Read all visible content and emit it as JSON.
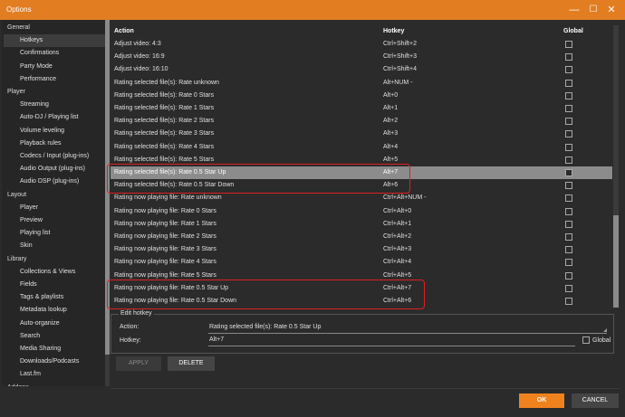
{
  "window": {
    "title": "Options",
    "controls": {
      "minimize": "—",
      "maximize": "☐",
      "close": "✕"
    }
  },
  "sidebar": {
    "groups": [
      {
        "label": "General",
        "items": [
          "Hotkeys",
          "Confirmations",
          "Party Mode",
          "Performance"
        ]
      },
      {
        "label": "Player",
        "items": [
          "Streaming",
          "Auto-DJ / Playing list",
          "Volume leveling",
          "Playback rules",
          "Codecs / Input (plug-ins)",
          "Audio Output (plug-ins)",
          "Audio DSP (plug-ins)"
        ]
      },
      {
        "label": "Layout",
        "items": [
          "Player",
          "Preview",
          "Playing list",
          "Skin"
        ]
      },
      {
        "label": "Library",
        "items": [
          "Collections & Views",
          "Fields",
          "Tags & playlists",
          "Metadata lookup",
          "Auto-organize",
          "Search",
          "Media Sharing",
          "Downloads/Podcasts",
          "Last.fm"
        ]
      },
      {
        "label": "Addons",
        "items": []
      }
    ],
    "selected": "Hotkeys"
  },
  "table": {
    "headers": {
      "action": "Action",
      "hotkey": "Hotkey",
      "global": "Global"
    },
    "rows": [
      {
        "action": "Adjust video: 4:3",
        "hotkey": "Ctrl+Shift+2"
      },
      {
        "action": "Adjust video: 16:9",
        "hotkey": "Ctrl+Shift+3"
      },
      {
        "action": "Adjust video: 16:10",
        "hotkey": "Ctrl+Shift+4"
      },
      {
        "action": "Rating selected file(s): Rate unknown",
        "hotkey": "Alt+NUM -"
      },
      {
        "action": "Rating selected file(s): Rate 0 Stars",
        "hotkey": "Alt+0"
      },
      {
        "action": "Rating selected file(s): Rate 1 Stars",
        "hotkey": "Alt+1"
      },
      {
        "action": "Rating selected file(s): Rate 2 Stars",
        "hotkey": "Alt+2"
      },
      {
        "action": "Rating selected file(s): Rate 3 Stars",
        "hotkey": "Alt+3"
      },
      {
        "action": "Rating selected file(s): Rate 4 Stars",
        "hotkey": "Alt+4"
      },
      {
        "action": "Rating selected file(s): Rate 5 Stars",
        "hotkey": "Alt+5"
      },
      {
        "action": "Rating selected file(s): Rate 0.5 Star Up",
        "hotkey": "Alt+7"
      },
      {
        "action": "Rating selected file(s): Rate 0.5 Star Down",
        "hotkey": "Alt+6"
      },
      {
        "action": "Rating now playing file: Rate unknown",
        "hotkey": "Ctrl+Alt+NUM -"
      },
      {
        "action": "Rating now playing file: Rate 0 Stars",
        "hotkey": "Ctrl+Alt+0"
      },
      {
        "action": "Rating now playing file: Rate 1 Stars",
        "hotkey": "Ctrl+Alt+1"
      },
      {
        "action": "Rating now playing file: Rate 2 Stars",
        "hotkey": "Ctrl+Alt+2"
      },
      {
        "action": "Rating now playing file: Rate 3 Stars",
        "hotkey": "Ctrl+Alt+3"
      },
      {
        "action": "Rating now playing file: Rate 4 Stars",
        "hotkey": "Ctrl+Alt+4"
      },
      {
        "action": "Rating now playing file: Rate 5 Stars",
        "hotkey": "Ctrl+Alt+5"
      },
      {
        "action": "Rating now playing file: Rate 0.5 Star Up",
        "hotkey": "Ctrl+Alt+7"
      },
      {
        "action": "Rating now playing file: Rate 0.5 Star Down",
        "hotkey": "Ctrl+Alt+6"
      }
    ],
    "selected_row": 10,
    "highlighted_rows": [
      [
        10,
        11
      ],
      [
        19,
        20
      ]
    ]
  },
  "edit_hotkey": {
    "legend": "Edit hotkey",
    "action_label": "Action:",
    "action_value": "Rating selected file(s): Rate 0.5 Star Up",
    "hotkey_label": "Hotkey:",
    "hotkey_value": "Alt+7",
    "global_label": "Global"
  },
  "buttons": {
    "apply": "APPLY",
    "delete": "DELETE",
    "ok": "OK",
    "cancel": "CANCEL"
  },
  "colors": {
    "accent": "#e27d22",
    "ok_button": "#f0821e",
    "highlight_box": "#e02020",
    "selected_row": "#8c8c8c"
  }
}
